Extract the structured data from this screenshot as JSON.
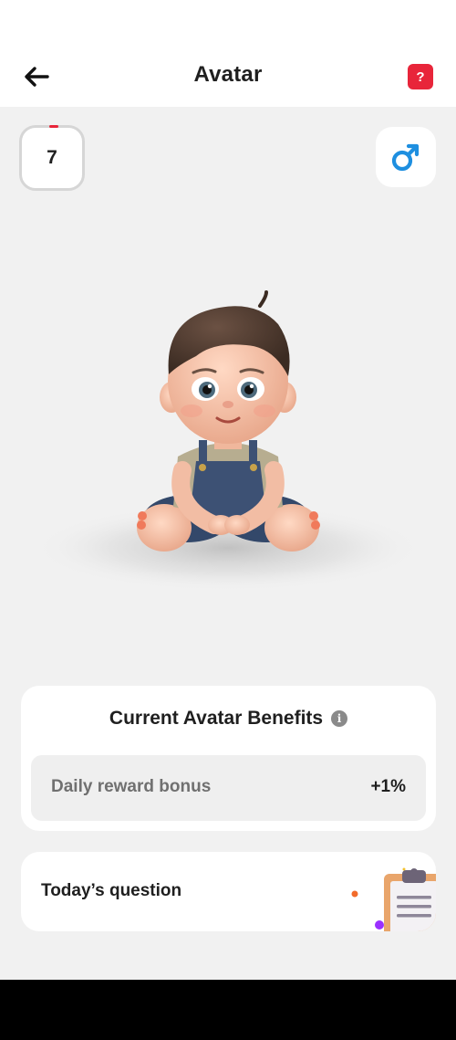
{
  "header": {
    "title": "Avatar",
    "back_icon": "arrow-left-icon",
    "help_label": "?"
  },
  "level": {
    "value": "7",
    "progress_fraction": 0.15
  },
  "gender": {
    "icon": "male-symbol-icon",
    "color": "#1e8fe0"
  },
  "avatar": {
    "image": "baby-avatar-illustration"
  },
  "benefits": {
    "title": "Current Avatar Benefits",
    "info_icon": "info-icon",
    "info_glyph": "i",
    "items": [
      {
        "label": "Daily reward bonus",
        "value": "+1%"
      }
    ]
  },
  "question": {
    "label": "Today’s question",
    "icon": "clipboard-icon"
  },
  "colors": {
    "accent_red": "#e8253a",
    "background": "#f1f1f1",
    "card": "#ffffff",
    "male_blue": "#1e8fe0"
  }
}
